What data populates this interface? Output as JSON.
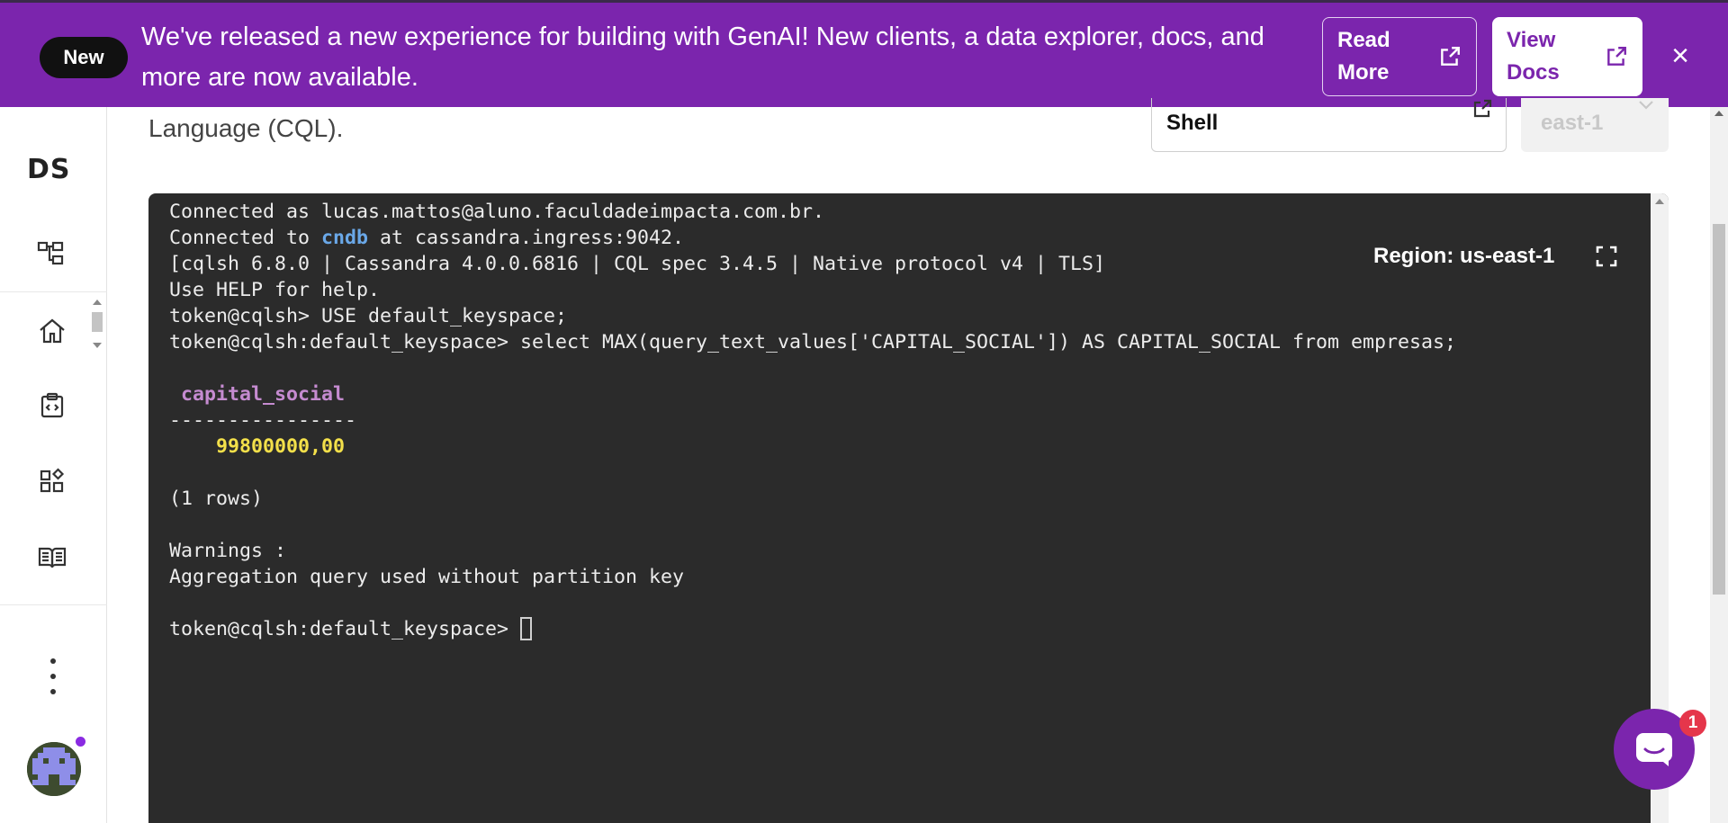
{
  "banner": {
    "badge": "New",
    "message": "We've released a new experience for building with GenAI! New clients, a data explorer, docs, and more are now available.",
    "read_more_label": "Read More",
    "view_docs_label": "View Docs",
    "close_glyph": "×",
    "background_color": "#7b25ad"
  },
  "sidebar": {
    "logo": "DS",
    "items": [
      {
        "icon": "org-tree-icon"
      },
      {
        "icon": "home-icon"
      },
      {
        "icon": "code-clipboard-icon"
      },
      {
        "icon": "apps-grid-icon"
      },
      {
        "icon": "book-icon"
      }
    ]
  },
  "header": {
    "description_tail": "Language (CQL).",
    "shell_select": "Shell",
    "region_select": "east-1"
  },
  "terminal": {
    "region_label": "Region: us-east-1",
    "line1": "Connected as lucas.mattos@aluno.faculdadeimpacta.com.br.",
    "line2_prefix": "Connected to ",
    "line2_db": "cndb",
    "line2_suffix": " at cassandra.ingress:9042.",
    "line3": "[cqlsh 6.8.0 | Cassandra 4.0.0.6816 | CQL spec 3.4.5 | Native protocol v4 | TLS]",
    "line4": "Use HELP for help.",
    "line5": "token@cqlsh> USE default_keyspace;",
    "line6": "token@cqlsh:default_keyspace> select MAX(query_text_values['CAPITAL_SOCIAL']) AS CAPITAL_SOCIAL from empresas;",
    "result_header": " capital_social",
    "result_sep": "----------------",
    "result_value": "    99800000,00",
    "row_count": "(1 rows)",
    "warnings_title": "Warnings :",
    "warning_text": "Aggregation query used without partition key",
    "prompt": "token@cqlsh:default_keyspace> "
  },
  "chat": {
    "badge_count": "1"
  }
}
